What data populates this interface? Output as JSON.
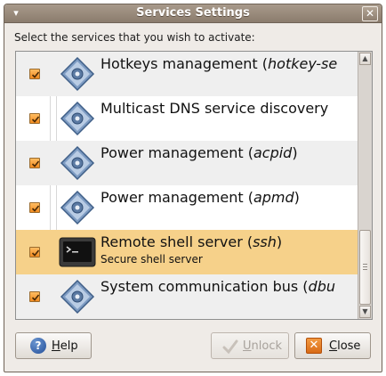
{
  "window": {
    "title": "Services Settings",
    "menu_icon": "▾",
    "close_icon": "✕"
  },
  "prompt": "Select the services that you wish to activate:",
  "services": [
    {
      "name_plain": "Hotkeys management (",
      "name_cmd": "hotkey-se",
      "name_tail": "",
      "checked": true,
      "icon": "service-gear-icon"
    },
    {
      "name_plain": "Multicast DNS service discovery",
      "name_cmd": "",
      "name_tail": "",
      "checked": true,
      "icon": "service-gear-icon"
    },
    {
      "name_plain": "Power management (",
      "name_cmd": "acpid",
      "name_tail": ")",
      "checked": true,
      "icon": "service-gear-icon"
    },
    {
      "name_plain": "Power management (",
      "name_cmd": "apmd",
      "name_tail": ")",
      "checked": true,
      "icon": "service-gear-icon"
    },
    {
      "name_plain": "Remote shell server (",
      "name_cmd": "ssh",
      "name_tail": ")",
      "description": "Secure shell server",
      "checked": true,
      "selected": true,
      "icon": "terminal-icon"
    },
    {
      "name_plain": "System communication bus (",
      "name_cmd": "dbu",
      "name_tail": "",
      "checked": true,
      "icon": "service-gear-icon"
    }
  ],
  "buttons": {
    "help": {
      "pre": "",
      "mnemonic": "H",
      "post": "elp"
    },
    "unlock": {
      "pre": "",
      "mnemonic": "U",
      "post": "nlock",
      "enabled": false
    },
    "close": {
      "pre": "",
      "mnemonic": "C",
      "post": "lose"
    }
  },
  "colors": {
    "selection": "#f6d18a",
    "checkbox": "#f08a1f",
    "titlebar": "#8b7c6d"
  }
}
